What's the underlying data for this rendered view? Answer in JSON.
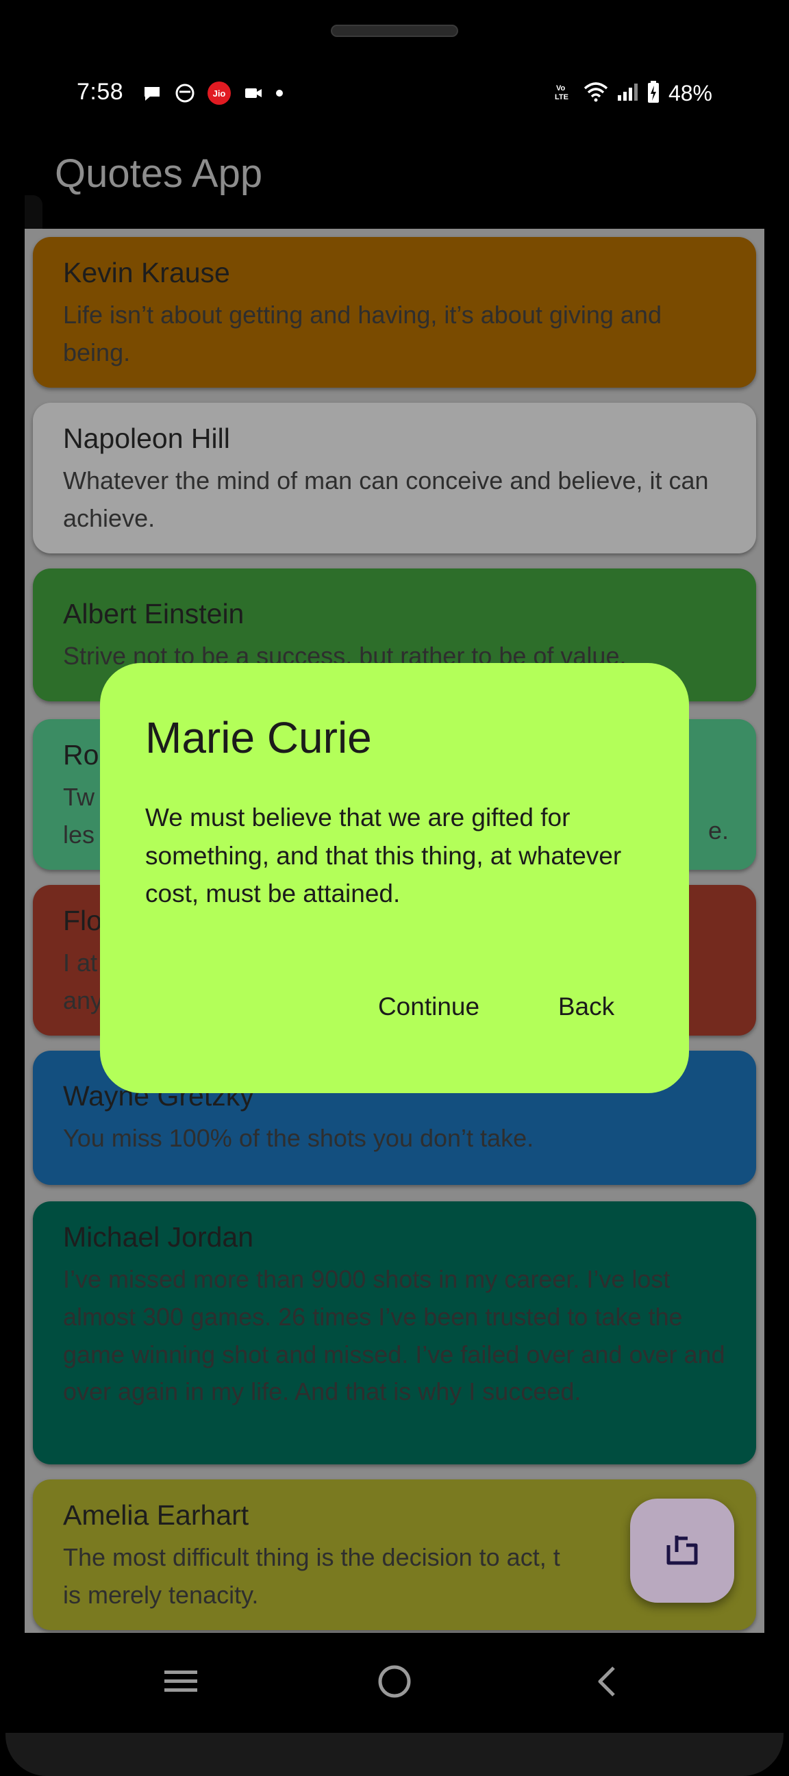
{
  "status_bar": {
    "time": "7:58",
    "battery": "48%",
    "jio_label": "Jio"
  },
  "appbar": {
    "title": "Quotes App"
  },
  "quotes": [
    {
      "author": "Kevin Krause",
      "text": "Life isn’t about getting and having, it’s about giving and being.",
      "color": "#7a4b00"
    },
    {
      "author": "Napoleon Hill",
      "text": "Whatever the mind of man can conceive and believe, it can achieve.",
      "color": "#a3a3a3"
    },
    {
      "author": "Albert Einstein",
      "text": "Strive not to be a success, but rather to be of value.",
      "color": "#2d6e2a"
    },
    {
      "author": "Ro",
      "text": "Tw",
      "text2": "les",
      "text_right": "e.",
      "color": "#3b8c63"
    },
    {
      "author": "Flo",
      "text": "I at",
      "text2": "any",
      "color": "#742a1e"
    },
    {
      "author": "Wayne Gretzky",
      "text": "You miss 100% of the shots you don’t take.",
      "color": "#134f7f"
    },
    {
      "author": "Michael Jordan",
      "text": "I’ve missed more than 9000 shots in my career. I’ve lost almost 300 games. 26 times I’ve been trusted to take the game winning shot and missed. I’ve failed over and over and over again in my life. And that is why I succeed.",
      "color": "#004d3f"
    },
    {
      "author": "Amelia Earhart",
      "text": "The most difficult thing is the decision to act, t",
      "text2": "is merely tenacity.",
      "color": "#7a7a20"
    }
  ],
  "dialog": {
    "title": "Marie Curie",
    "body": "We must believe that we are gifted for something, and that this thing, at whatever cost, must be attained.",
    "continue_label": "Continue",
    "back_label": "Back",
    "color": "#b3ff59"
  },
  "fab": {
    "icon": "share-icon"
  },
  "navbar": {
    "items": [
      "recents-icon",
      "home-icon",
      "back-icon"
    ]
  }
}
